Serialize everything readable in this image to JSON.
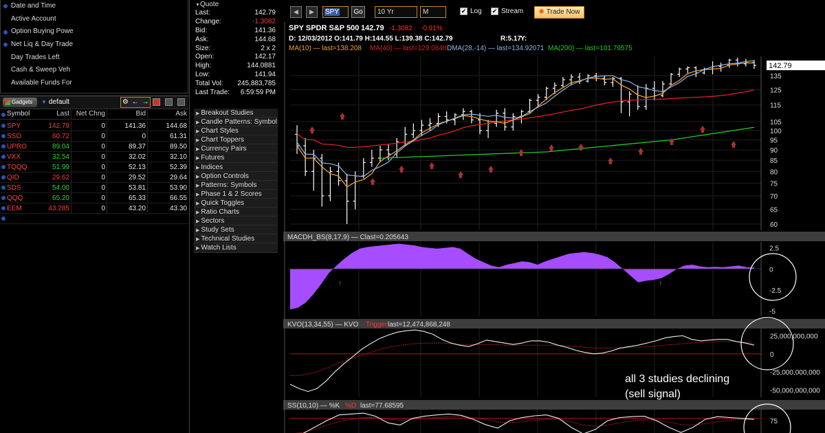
{
  "account": {
    "items": [
      {
        "label": "Date and Time",
        "dot": true
      },
      {
        "label": "Active Account",
        "dot": false
      },
      {
        "label": "Option Buying Powe",
        "dot": true
      },
      {
        "label": "Net Liq & Day Trade",
        "dot": true
      },
      {
        "label": "Day Trades Left",
        "dot": false
      },
      {
        "label": "Cash & Sweep Veh",
        "dot": false
      },
      {
        "label": "Available Funds For",
        "dot": false
      }
    ]
  },
  "gadgets": {
    "button": "Gadgets",
    "watchlist": "default",
    "tools": "⚙ ← →"
  },
  "watchlist": {
    "headers": {
      "symbol": "Symbol",
      "last": "Last",
      "net": "Net Chng",
      "bid": "Bid",
      "ask": "Ask"
    },
    "rows": [
      {
        "symbol": "SPY",
        "last": "142.79",
        "net": "0",
        "bid": "141.36",
        "ask": "144.68",
        "dir": "neg"
      },
      {
        "symbol": "SSO",
        "last": "60.72",
        "net": "0",
        "bid": "0",
        "ask": "61.31",
        "dir": "neg"
      },
      {
        "symbol": "UPRO",
        "last": "89.04",
        "net": "0",
        "bid": "89.37",
        "ask": "89.50",
        "dir": "pos"
      },
      {
        "symbol": "VXX",
        "last": "32.54",
        "net": "0",
        "bid": "32.02",
        "ask": "32.10",
        "dir": "pos"
      },
      {
        "symbol": "TQQQ",
        "last": "51.99",
        "net": "0",
        "bid": "52.13",
        "ask": "52.39",
        "dir": "pos"
      },
      {
        "symbol": "QID",
        "last": "29.62",
        "net": "0",
        "bid": "29.52",
        "ask": "29.64",
        "dir": "neg"
      },
      {
        "symbol": "SDS",
        "last": "54.00",
        "net": "0",
        "bid": "53.81",
        "ask": "53.90",
        "dir": "pos"
      },
      {
        "symbol": "QQQ",
        "last": "65.20",
        "net": "0",
        "bid": "65.33",
        "ask": "66.55",
        "dir": "pos"
      },
      {
        "symbol": "EEM",
        "last": "43.285",
        "net": "0",
        "bid": "43.20",
        "ask": "43.30",
        "dir": "neg"
      }
    ]
  },
  "quote": {
    "header": "Quote",
    "fields": [
      {
        "label": "Last:",
        "value": "142.79",
        "cls": ""
      },
      {
        "label": "Change:",
        "value": "-1.3082",
        "cls": "neg"
      },
      {
        "label": "Bid:",
        "value": "141.36",
        "cls": ""
      },
      {
        "label": "Ask:",
        "value": "144.68",
        "cls": ""
      },
      {
        "label": "Size:",
        "value": "2 x 2",
        "cls": ""
      },
      {
        "label": "Open:",
        "value": "142.17",
        "cls": ""
      },
      {
        "label": "High:",
        "value": "144.0881",
        "cls": ""
      },
      {
        "label": "Low:",
        "value": "141.94",
        "cls": ""
      },
      {
        "label": "Total Vol:",
        "value": "245,883,785",
        "cls": ""
      },
      {
        "label": "Last Trade:",
        "value": "6:59:59 PM",
        "cls": ""
      }
    ]
  },
  "studies": [
    "Breakout Studies",
    "Candle Patterns: Symbol",
    "Chart Styles",
    "Chart Toppers",
    "Currency Pairs",
    "Futures",
    "Indices",
    "Option Controls",
    "Patterns: Symbols",
    "Phase 1 & 2 Scores",
    "Quick Toggles",
    "Ratio Charts",
    "Sectors",
    "Study Sets",
    "Technical Studies",
    "Watch Lists"
  ],
  "toolbar": {
    "symbol": "SPY",
    "go": "Go",
    "period": "10 Yr",
    "interval": "M",
    "log_label": "Log",
    "stream_label": "Stream",
    "trade_label": "Trade Now",
    "log_checked": true,
    "stream_checked": true
  },
  "chart_header": {
    "title": "SPY SPDR S&P 500",
    "price": "142.79",
    "change": "-1.3082",
    "change_pct": "-0.91%",
    "ohlc": "D: 12/03/2012 O:141.79 H:144.55 L:139.38 C:142.79",
    "r_label": "R:5.17",
    "y_label": "Y:",
    "legend": [
      {
        "text": "MA(10) — last=138.208",
        "color": "#f0a030"
      },
      {
        "text": "MA(40) — last=129.0848",
        "color": "#e02020"
      },
      {
        "text": "DMA(28,-14) — last=134.92071",
        "color": "#8fb7e8"
      },
      {
        "text": "MA(200) — last=101.79575",
        "color": "#22cc22"
      }
    ]
  },
  "chart_data": [
    {
      "type": "ohlc",
      "title": "SPY SPDR S&P 500",
      "price_axis_ticks": [
        "135",
        "125",
        "115",
        "105",
        "100",
        "95",
        "90",
        "85",
        "80",
        "75",
        "70",
        "65",
        "60"
      ],
      "last_price_tag": "142.79",
      "log_scale": true,
      "bars": [
        {
          "o": 98,
          "h": 103,
          "l": 88,
          "c": 92
        },
        {
          "o": 92,
          "h": 96,
          "l": 78,
          "c": 80
        },
        {
          "o": 80,
          "h": 90,
          "l": 72,
          "c": 86
        },
        {
          "o": 86,
          "h": 88,
          "l": 66,
          "c": 70
        },
        {
          "o": 70,
          "h": 82,
          "l": 68,
          "c": 80
        },
        {
          "o": 80,
          "h": 84,
          "l": 74,
          "c": 76
        },
        {
          "o": 76,
          "h": 79,
          "l": 60,
          "c": 68
        },
        {
          "o": 68,
          "h": 80,
          "l": 65,
          "c": 78
        },
        {
          "o": 78,
          "h": 86,
          "l": 77,
          "c": 84
        },
        {
          "o": 84,
          "h": 90,
          "l": 82,
          "c": 86
        },
        {
          "o": 86,
          "h": 92,
          "l": 84,
          "c": 90
        },
        {
          "o": 90,
          "h": 93,
          "l": 85,
          "c": 88
        },
        {
          "o": 88,
          "h": 96,
          "l": 86,
          "c": 94
        },
        {
          "o": 94,
          "h": 102,
          "l": 92,
          "c": 98
        },
        {
          "o": 98,
          "h": 104,
          "l": 96,
          "c": 100
        },
        {
          "o": 100,
          "h": 106,
          "l": 97,
          "c": 103
        },
        {
          "o": 103,
          "h": 107,
          "l": 100,
          "c": 104
        },
        {
          "o": 104,
          "h": 110,
          "l": 102,
          "c": 108
        },
        {
          "o": 108,
          "h": 111,
          "l": 104,
          "c": 106
        },
        {
          "o": 106,
          "h": 110,
          "l": 103,
          "c": 109
        },
        {
          "o": 109,
          "h": 113,
          "l": 106,
          "c": 111
        },
        {
          "o": 111,
          "h": 112,
          "l": 104,
          "c": 106
        },
        {
          "o": 106,
          "h": 110,
          "l": 98,
          "c": 100
        },
        {
          "o": 100,
          "h": 106,
          "l": 96,
          "c": 104
        },
        {
          "o": 104,
          "h": 112,
          "l": 102,
          "c": 110
        },
        {
          "o": 110,
          "h": 113,
          "l": 100,
          "c": 102
        },
        {
          "o": 102,
          "h": 110,
          "l": 100,
          "c": 108
        },
        {
          "o": 108,
          "h": 112,
          "l": 104,
          "c": 111
        },
        {
          "o": 111,
          "h": 119,
          "l": 110,
          "c": 118
        },
        {
          "o": 118,
          "h": 122,
          "l": 114,
          "c": 120
        },
        {
          "o": 120,
          "h": 127,
          "l": 118,
          "c": 126
        },
        {
          "o": 126,
          "h": 130,
          "l": 122,
          "c": 128
        },
        {
          "o": 128,
          "h": 134,
          "l": 126,
          "c": 132
        },
        {
          "o": 132,
          "h": 136,
          "l": 128,
          "c": 134
        },
        {
          "o": 134,
          "h": 137,
          "l": 129,
          "c": 131
        },
        {
          "o": 131,
          "h": 136,
          "l": 130,
          "c": 135
        },
        {
          "o": 135,
          "h": 137,
          "l": 131,
          "c": 133
        },
        {
          "o": 133,
          "h": 135,
          "l": 128,
          "c": 130
        },
        {
          "o": 130,
          "h": 134,
          "l": 127,
          "c": 133
        },
        {
          "o": 133,
          "h": 134,
          "l": 110,
          "c": 117
        },
        {
          "o": 117,
          "h": 124,
          "l": 108,
          "c": 122
        },
        {
          "o": 122,
          "h": 128,
          "l": 112,
          "c": 114
        },
        {
          "o": 114,
          "h": 129,
          "l": 112,
          "c": 126
        },
        {
          "o": 126,
          "h": 131,
          "l": 118,
          "c": 121
        },
        {
          "o": 121,
          "h": 131,
          "l": 120,
          "c": 129
        },
        {
          "o": 129,
          "h": 137,
          "l": 128,
          "c": 136
        },
        {
          "o": 136,
          "h": 141,
          "l": 134,
          "c": 140
        },
        {
          "o": 140,
          "h": 142,
          "l": 137,
          "c": 141
        },
        {
          "o": 141,
          "h": 142,
          "l": 134,
          "c": 137
        },
        {
          "o": 137,
          "h": 141,
          "l": 136,
          "c": 140
        },
        {
          "o": 140,
          "h": 146,
          "l": 136,
          "c": 142
        },
        {
          "o": 142,
          "h": 145,
          "l": 138,
          "c": 143
        },
        {
          "o": 143,
          "h": 148,
          "l": 141,
          "c": 147
        },
        {
          "o": 147,
          "h": 149,
          "l": 142,
          "c": 144
        },
        {
          "o": 144,
          "h": 148,
          "l": 142,
          "c": 145
        },
        {
          "o": 145,
          "h": 147,
          "l": 140,
          "c": 142.79
        }
      ]
    },
    {
      "type": "area",
      "title": "MACDH_BS(8,17,9) — Clast=0.205643",
      "ylim": [
        -5,
        2.5
      ],
      "ticks": [
        "2.5",
        "0",
        "-2.5",
        "-5"
      ],
      "values": [
        -4.8,
        -4.6,
        -4,
        -3,
        -1.8,
        -0.5,
        0.4,
        1.2,
        1.9,
        2.4,
        2.6,
        2.7,
        2.8,
        2.9,
        3.0,
        2.9,
        2.8,
        2.6,
        2.5,
        2.4,
        2.5,
        2.6,
        2.4,
        1.8,
        1.2,
        0.8,
        0.4,
        0.2,
        0.5,
        0.7,
        0.9,
        0.8,
        0.5,
        0.9,
        1.2,
        1.5,
        1.8,
        1.9,
        2.0,
        1.9,
        1.7,
        1.4,
        0.8,
        0,
        -0.8,
        -1.6,
        -1.4,
        -1.3,
        -1.1,
        -0.6,
        0,
        0.4,
        0.5,
        0.3,
        0.2,
        0.25,
        0.2,
        0.3,
        0.4,
        0.2,
        0.15
      ]
    },
    {
      "type": "line",
      "title": "KVO(13,34,55) — KVO",
      "legend": [
        "KVO",
        "Trigger",
        "last=12,474,868,248"
      ],
      "ticks": [
        "25,000,000,000",
        "0",
        "-25,000,000,000",
        "-50,000,000,000"
      ],
      "ylim": [
        -60000000000,
        35000000000
      ],
      "kvo": [
        -42,
        -48,
        -52,
        -48,
        -38,
        -25,
        -14,
        -4,
        6,
        14,
        21,
        26,
        30,
        32,
        33,
        31,
        27,
        20,
        15,
        12,
        10,
        14,
        19,
        17,
        15,
        13,
        15,
        18,
        18,
        16,
        12,
        9,
        5,
        2,
        0,
        1,
        4,
        8,
        10,
        12,
        15,
        18,
        22,
        24,
        25,
        20,
        18,
        19,
        20,
        20,
        17,
        15,
        12
      ],
      "trigger": [
        -30,
        -30,
        -28,
        -25,
        -20,
        -15,
        -10,
        -6,
        -2,
        2,
        6,
        9,
        11,
        13,
        14,
        15,
        15,
        15,
        14,
        13,
        13,
        13,
        13,
        13,
        12,
        12,
        12,
        12,
        12,
        12,
        12,
        11,
        10,
        9,
        8,
        8,
        8,
        8,
        9,
        9,
        10,
        11,
        12,
        13,
        14,
        15,
        16,
        16,
        17,
        17,
        17,
        16,
        15
      ]
    },
    {
      "type": "line",
      "title": "SS(10,10) — %K",
      "legend": [
        "%K",
        "%D",
        "last=77.68595"
      ],
      "ticks": [
        "75"
      ],
      "ylim": [
        0,
        100
      ],
      "k": [
        40,
        45,
        60,
        75,
        88,
        90,
        92,
        85,
        70,
        65,
        80,
        85,
        88,
        90,
        87,
        78,
        66,
        58,
        75,
        82,
        86,
        88,
        80,
        60,
        45,
        55,
        75,
        82,
        84,
        85,
        75,
        60,
        48,
        60,
        78,
        84,
        82,
        80,
        78
      ],
      "d": [
        45,
        48,
        55,
        65,
        72,
        78,
        82,
        82,
        78,
        76,
        78,
        80,
        82,
        84,
        84,
        82,
        78,
        72,
        70,
        73,
        76,
        78,
        78,
        72,
        65,
        62,
        65,
        70,
        74,
        77,
        76,
        72,
        66,
        65,
        68,
        72,
        76,
        78,
        78
      ]
    }
  ],
  "annotations": {
    "text1": "all 3 studies declining",
    "text2": "(sell signal)"
  },
  "colors": {
    "ma10": "#f0a030",
    "ma40": "#e02020",
    "dma": "#8fb7e8",
    "ma200": "#22cc22",
    "macd": "#a64dff",
    "header_bar": "#3d3d3d"
  }
}
